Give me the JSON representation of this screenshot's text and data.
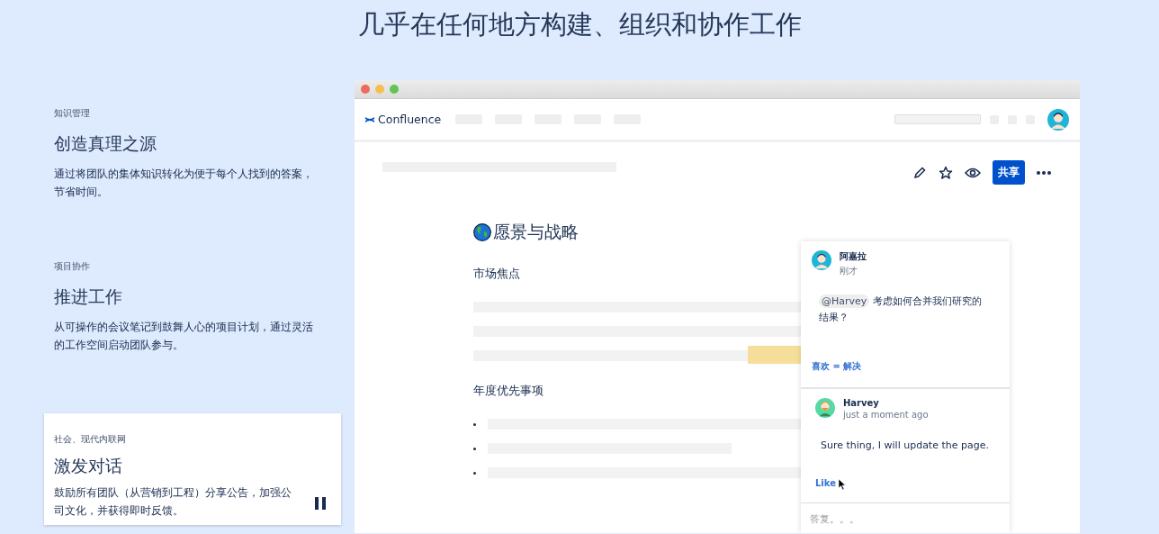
{
  "heading": "几乎在任何地方构建、组织和协作工作",
  "features": [
    {
      "category": "知识管理",
      "title": "创造真理之源",
      "description": "通过将团队的集体知识转化为便于每个人找到的答案，节省时间。",
      "selected": false
    },
    {
      "category": "项目协作",
      "title": "推进工作",
      "description": "从可操作的会议笔记到鼓舞人心的项目计划，通过灵活的工作空间启动团队参与。",
      "selected": false
    },
    {
      "category": "社会、现代内联网",
      "title": "激发对话",
      "description": "鼓励所有团队（从营销到工程）分享公告，加强公司文化，并获得即时反馈。",
      "selected": true
    }
  ],
  "app": {
    "logo": "Confluence",
    "share_button": "共享",
    "page_title": "愿景与战略",
    "sections": [
      {
        "heading": "市场焦点",
        "kind": "lines"
      },
      {
        "heading": "年度优先事项",
        "kind": "bullets"
      }
    ],
    "comments": [
      {
        "author": "阿嘉拉",
        "time": "刚才",
        "mention": "@Harvey",
        "text": "考虑如何合并我们研究的结果？",
        "actions": "喜欢 = 解决"
      },
      {
        "author": "Harvey",
        "time": "just a moment ago",
        "text": "Sure thing, I will update the page.",
        "actions": "Like"
      }
    ],
    "reply_placeholder": "答复。。。"
  }
}
